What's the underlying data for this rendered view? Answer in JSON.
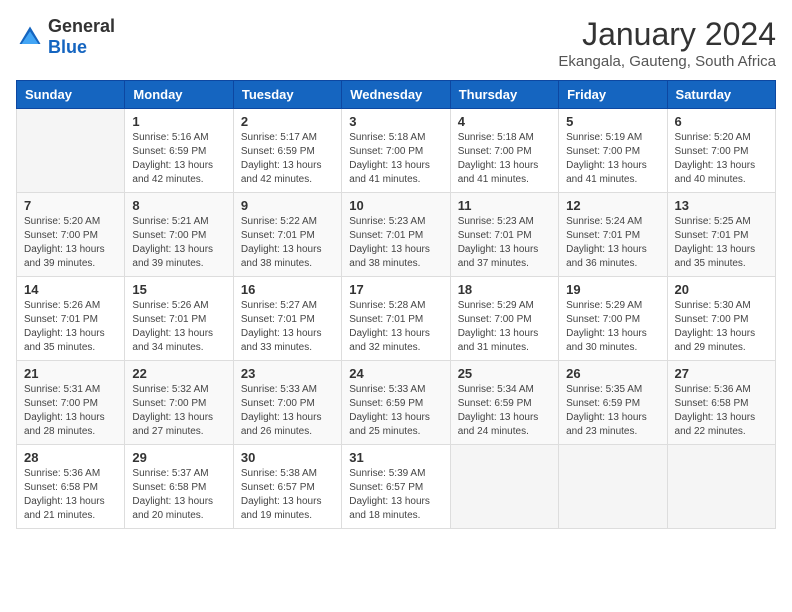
{
  "logo": {
    "general": "General",
    "blue": "Blue"
  },
  "header": {
    "month": "January 2024",
    "location": "Ekangala, Gauteng, South Africa"
  },
  "weekdays": [
    "Sunday",
    "Monday",
    "Tuesday",
    "Wednesday",
    "Thursday",
    "Friday",
    "Saturday"
  ],
  "weeks": [
    [
      {
        "day": "",
        "info": ""
      },
      {
        "day": "1",
        "info": "Sunrise: 5:16 AM\nSunset: 6:59 PM\nDaylight: 13 hours\nand 42 minutes."
      },
      {
        "day": "2",
        "info": "Sunrise: 5:17 AM\nSunset: 6:59 PM\nDaylight: 13 hours\nand 42 minutes."
      },
      {
        "day": "3",
        "info": "Sunrise: 5:18 AM\nSunset: 7:00 PM\nDaylight: 13 hours\nand 41 minutes."
      },
      {
        "day": "4",
        "info": "Sunrise: 5:18 AM\nSunset: 7:00 PM\nDaylight: 13 hours\nand 41 minutes."
      },
      {
        "day": "5",
        "info": "Sunrise: 5:19 AM\nSunset: 7:00 PM\nDaylight: 13 hours\nand 41 minutes."
      },
      {
        "day": "6",
        "info": "Sunrise: 5:20 AM\nSunset: 7:00 PM\nDaylight: 13 hours\nand 40 minutes."
      }
    ],
    [
      {
        "day": "7",
        "info": "Sunrise: 5:20 AM\nSunset: 7:00 PM\nDaylight: 13 hours\nand 39 minutes."
      },
      {
        "day": "8",
        "info": "Sunrise: 5:21 AM\nSunset: 7:00 PM\nDaylight: 13 hours\nand 39 minutes."
      },
      {
        "day": "9",
        "info": "Sunrise: 5:22 AM\nSunset: 7:01 PM\nDaylight: 13 hours\nand 38 minutes."
      },
      {
        "day": "10",
        "info": "Sunrise: 5:23 AM\nSunset: 7:01 PM\nDaylight: 13 hours\nand 38 minutes."
      },
      {
        "day": "11",
        "info": "Sunrise: 5:23 AM\nSunset: 7:01 PM\nDaylight: 13 hours\nand 37 minutes."
      },
      {
        "day": "12",
        "info": "Sunrise: 5:24 AM\nSunset: 7:01 PM\nDaylight: 13 hours\nand 36 minutes."
      },
      {
        "day": "13",
        "info": "Sunrise: 5:25 AM\nSunset: 7:01 PM\nDaylight: 13 hours\nand 35 minutes."
      }
    ],
    [
      {
        "day": "14",
        "info": "Sunrise: 5:26 AM\nSunset: 7:01 PM\nDaylight: 13 hours\nand 35 minutes."
      },
      {
        "day": "15",
        "info": "Sunrise: 5:26 AM\nSunset: 7:01 PM\nDaylight: 13 hours\nand 34 minutes."
      },
      {
        "day": "16",
        "info": "Sunrise: 5:27 AM\nSunset: 7:01 PM\nDaylight: 13 hours\nand 33 minutes."
      },
      {
        "day": "17",
        "info": "Sunrise: 5:28 AM\nSunset: 7:01 PM\nDaylight: 13 hours\nand 32 minutes."
      },
      {
        "day": "18",
        "info": "Sunrise: 5:29 AM\nSunset: 7:00 PM\nDaylight: 13 hours\nand 31 minutes."
      },
      {
        "day": "19",
        "info": "Sunrise: 5:29 AM\nSunset: 7:00 PM\nDaylight: 13 hours\nand 30 minutes."
      },
      {
        "day": "20",
        "info": "Sunrise: 5:30 AM\nSunset: 7:00 PM\nDaylight: 13 hours\nand 29 minutes."
      }
    ],
    [
      {
        "day": "21",
        "info": "Sunrise: 5:31 AM\nSunset: 7:00 PM\nDaylight: 13 hours\nand 28 minutes."
      },
      {
        "day": "22",
        "info": "Sunrise: 5:32 AM\nSunset: 7:00 PM\nDaylight: 13 hours\nand 27 minutes."
      },
      {
        "day": "23",
        "info": "Sunrise: 5:33 AM\nSunset: 7:00 PM\nDaylight: 13 hours\nand 26 minutes."
      },
      {
        "day": "24",
        "info": "Sunrise: 5:33 AM\nSunset: 6:59 PM\nDaylight: 13 hours\nand 25 minutes."
      },
      {
        "day": "25",
        "info": "Sunrise: 5:34 AM\nSunset: 6:59 PM\nDaylight: 13 hours\nand 24 minutes."
      },
      {
        "day": "26",
        "info": "Sunrise: 5:35 AM\nSunset: 6:59 PM\nDaylight: 13 hours\nand 23 minutes."
      },
      {
        "day": "27",
        "info": "Sunrise: 5:36 AM\nSunset: 6:58 PM\nDaylight: 13 hours\nand 22 minutes."
      }
    ],
    [
      {
        "day": "28",
        "info": "Sunrise: 5:36 AM\nSunset: 6:58 PM\nDaylight: 13 hours\nand 21 minutes."
      },
      {
        "day": "29",
        "info": "Sunrise: 5:37 AM\nSunset: 6:58 PM\nDaylight: 13 hours\nand 20 minutes."
      },
      {
        "day": "30",
        "info": "Sunrise: 5:38 AM\nSunset: 6:57 PM\nDaylight: 13 hours\nand 19 minutes."
      },
      {
        "day": "31",
        "info": "Sunrise: 5:39 AM\nSunset: 6:57 PM\nDaylight: 13 hours\nand 18 minutes."
      },
      {
        "day": "",
        "info": ""
      },
      {
        "day": "",
        "info": ""
      },
      {
        "day": "",
        "info": ""
      }
    ]
  ]
}
